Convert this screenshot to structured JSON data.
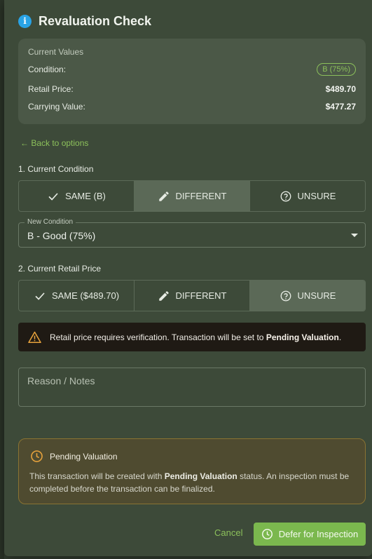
{
  "dialog": {
    "title": "Revaluation Check",
    "icon": "info-icon"
  },
  "current_values": {
    "heading": "Current Values",
    "rows": [
      {
        "label": "Condition:",
        "value": "B (75%)"
      },
      {
        "label": "Retail Price:",
        "value": "$489.70"
      },
      {
        "label": "Carrying Value:",
        "value": "$477.27"
      }
    ]
  },
  "back_link": "← Back to options",
  "condition_section": {
    "label": "1. Current Condition",
    "options": [
      "SAME (B)",
      "DIFFERENT",
      "UNSURE"
    ],
    "selected": "DIFFERENT"
  },
  "new_condition": {
    "legend": "New Condition",
    "value": "B - Good (75%)"
  },
  "price_section": {
    "label": "2. Current Retail Price",
    "options": [
      "SAME ($489.70)",
      "DIFFERENT",
      "UNSURE"
    ],
    "selected": "UNSURE"
  },
  "warning": {
    "text": "Retail price requires verification. Transaction will be set to ",
    "emphasis": "Pending Valuation",
    "suffix": "."
  },
  "notes": {
    "placeholder": "Reason / Notes",
    "value": ""
  },
  "pending": {
    "title": "Pending Valuation",
    "body_prefix": "This transaction will be created with ",
    "body_emphasis": "Pending Valuation",
    "body_suffix": " status. An inspection must be completed before the transaction can be finalized."
  },
  "actions": {
    "cancel": "Cancel",
    "defer": "Defer for Inspection"
  },
  "colors": {
    "accent_green": "#8cc05b",
    "button_green": "#7bb84e",
    "warning_amber": "#e7a23c",
    "info_blue": "#29a3e6"
  }
}
